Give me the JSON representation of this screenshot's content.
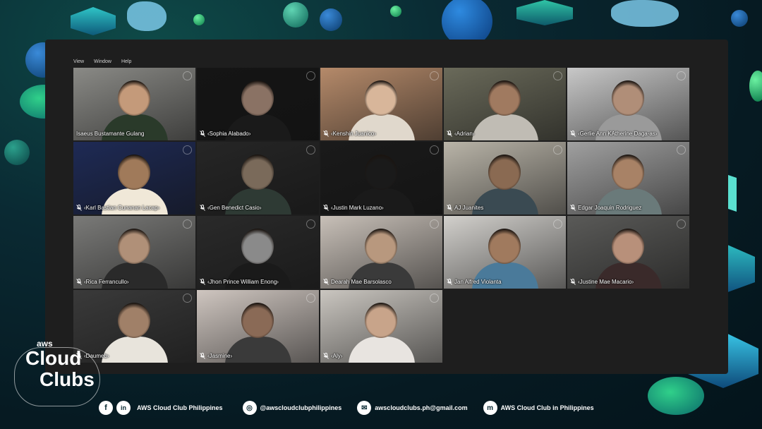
{
  "menu": {
    "items": [
      "View",
      "Window",
      "Help"
    ]
  },
  "participants": [
    {
      "name": "Isaeus Bustamante Gulang",
      "muted": false,
      "active": true,
      "bg": "#8a8a86",
      "skin": "#c49a7a",
      "shirt": "#2a3a2a"
    },
    {
      "name": "‹Sophia Alabado›",
      "muted": true,
      "active": false,
      "bg": "#151515",
      "skin": "#8a7264",
      "shirt": "#1a1a1a"
    },
    {
      "name": "‹Kenshin Juanico›",
      "muted": true,
      "active": false,
      "bg": "#b58a6a",
      "skin": "#d8b69a",
      "shirt": "#e0d8cc"
    },
    {
      "name": "‹Adrian›",
      "muted": true,
      "active": false,
      "bg": "#6a6a5a",
      "skin": "#a07a60",
      "shirt": "#c0bcb4"
    },
    {
      "name": "‹Gerlie Ann KAtherine Daga-as›",
      "muted": true,
      "active": false,
      "bg": "#c8c8c8",
      "skin": "#b08e78",
      "shirt": "#9a9a9a"
    },
    {
      "name": "‹Karl Bastian Cunanan Lacap›",
      "muted": true,
      "active": false,
      "bg": "#1e2a55",
      "skin": "#a07a5a",
      "shirt": "#f0e8d8"
    },
    {
      "name": "‹Gen Benedict Casio›",
      "muted": true,
      "active": false,
      "bg": "#262626",
      "skin": "#7a6a5a",
      "shirt": "#2e3a34"
    },
    {
      "name": "‹Justin Mark Luzano›",
      "muted": true,
      "active": false,
      "bg": "#1a1a1a",
      "skin": "#1a1a1a",
      "shirt": "#1a1a1a"
    },
    {
      "name": "AJ Juanites",
      "muted": true,
      "active": false,
      "bg": "#b9b4a8",
      "skin": "#8a6a52",
      "shirt": "#3a4a52"
    },
    {
      "name": "Edgar Joaquin Rodriguez",
      "muted": true,
      "active": false,
      "bg": "#a0a0a0",
      "skin": "#a88266",
      "shirt": "#6a7a7a"
    },
    {
      "name": "‹Rica Ferrancullo›",
      "muted": true,
      "active": false,
      "bg": "#7a7a78",
      "skin": "#b09078",
      "shirt": "#2a2a2a"
    },
    {
      "name": "‹Jhon Prince William Enong›",
      "muted": true,
      "active": false,
      "bg": "#2a2a2a",
      "skin": "#8a8a8a",
      "shirt": "#1a1a1a"
    },
    {
      "name": "Dearah Mae Barsolasco",
      "muted": true,
      "active": false,
      "bg": "#c8c0b8",
      "skin": "#b8987e",
      "shirt": "#3a3a3a"
    },
    {
      "name": "Jan Alfred Violanta",
      "muted": true,
      "active": false,
      "bg": "#d2d0cc",
      "skin": "#a07a5e",
      "shirt": "#4a7a9a"
    },
    {
      "name": "‹Justine Mae Macario›",
      "muted": true,
      "active": false,
      "bg": "#5a5a58",
      "skin": "#b8907a",
      "shirt": "#3a2a2a"
    },
    {
      "name": "‹Daumeb›",
      "muted": true,
      "active": false,
      "bg": "#3a3a3a",
      "skin": "#a08068",
      "shirt": "#e8e4dc"
    },
    {
      "name": "‹Jasmine›",
      "muted": true,
      "active": false,
      "bg": "#cfc6c0",
      "skin": "#8a6a56",
      "shirt": "#3a3a3a"
    },
    {
      "name": "‹Aly›",
      "muted": true,
      "active": false,
      "bg": "#cac6c0",
      "skin": "#c8a48a",
      "shirt": "#e8e4e0"
    }
  ],
  "footer": {
    "facebook_linkedin": "AWS Cloud Club Philippines",
    "instagram": "@awscloudclubphilippines",
    "email": "awscloudclubs.ph@gmail.com",
    "meetup": "AWS Cloud Club in Philippines"
  },
  "logo": {
    "aws": "aws",
    "line1": "Cloud",
    "line2": "Clubs"
  },
  "colors": {
    "active_border": "#e8736a",
    "background": "#0a2a33",
    "frame": "#1e1e1e"
  }
}
